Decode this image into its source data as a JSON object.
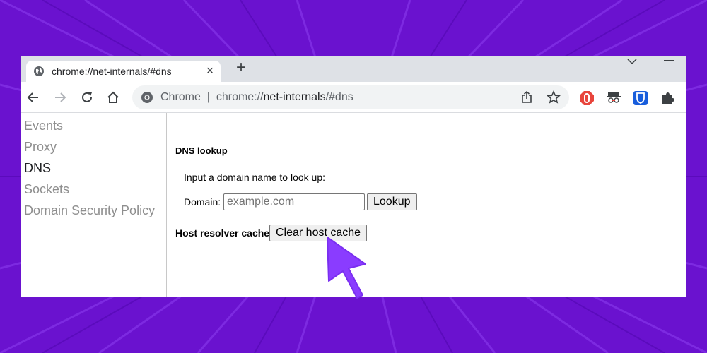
{
  "tab": {
    "title": "chrome://net-internals/#dns",
    "close_icon": "×",
    "new_tab_icon": "+"
  },
  "omnibox": {
    "prefix": "Chrome",
    "separator": "|",
    "url_scheme": "chrome://",
    "url_host": "net-internals",
    "url_path": "/#dns"
  },
  "sidebar": {
    "items": [
      {
        "label": "Events",
        "active": false
      },
      {
        "label": "Proxy",
        "active": false
      },
      {
        "label": "DNS",
        "active": true
      },
      {
        "label": "Sockets",
        "active": false
      },
      {
        "label": "Domain Security Policy",
        "active": false
      }
    ]
  },
  "main": {
    "dns_lookup_heading": "DNS lookup",
    "instruction": "Input a domain name to look up:",
    "domain_label": "Domain:",
    "domain_placeholder": "example.com",
    "lookup_button": "Lookup",
    "cache_heading": "Host resolver cache",
    "clear_cache_button": "Clear host cache"
  },
  "colors": {
    "background_purple": "#6a12cf",
    "cursor_purple": "#8a3cff",
    "tabstrip": "#dee1e6"
  }
}
